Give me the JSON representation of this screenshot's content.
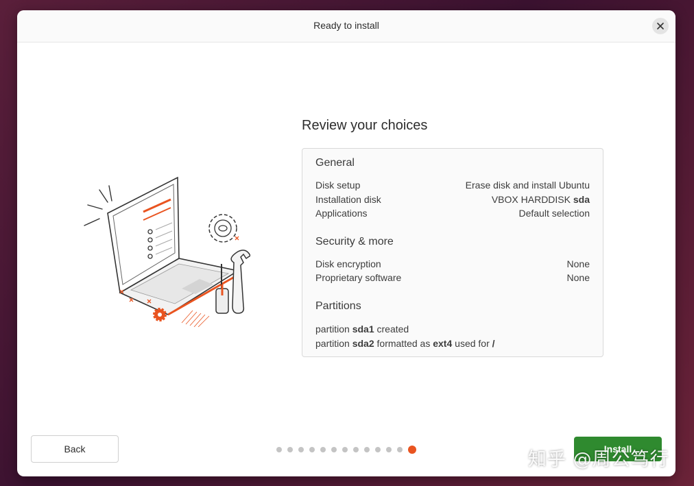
{
  "window": {
    "title": "Ready to install"
  },
  "main": {
    "heading": "Review your choices",
    "general": {
      "title": "General",
      "disk_setup_label": "Disk setup",
      "disk_setup_value": "Erase disk and install Ubuntu",
      "installation_disk_label": "Installation disk",
      "installation_disk_prefix": "VBOX HARDDISK",
      "installation_disk_bold": "sda",
      "applications_label": "Applications",
      "applications_value": "Default selection"
    },
    "security": {
      "title": "Security & more",
      "disk_encryption_label": "Disk encryption",
      "disk_encryption_value": "None",
      "proprietary_label": "Proprietary software",
      "proprietary_value": "None"
    },
    "partitions": {
      "title": "Partitions",
      "p1_prefix": "partition",
      "p1_name": "sda1",
      "p1_suffix": "created",
      "p2_prefix": "partition",
      "p2_name": "sda2",
      "p2_mid": "formatted as",
      "p2_fs": "ext4",
      "p2_mid2": "used for",
      "p2_mount": "/"
    }
  },
  "footer": {
    "back_label": "Back",
    "install_label": "Install",
    "progress": {
      "total_steps": 13,
      "current_step": 13
    }
  },
  "watermark": "知乎 @周公笃行",
  "colors": {
    "accent": "#e95420",
    "install_button": "#2f8a2f",
    "dot_inactive": "#c4c4c4"
  },
  "icons": {
    "close": "close-icon"
  }
}
